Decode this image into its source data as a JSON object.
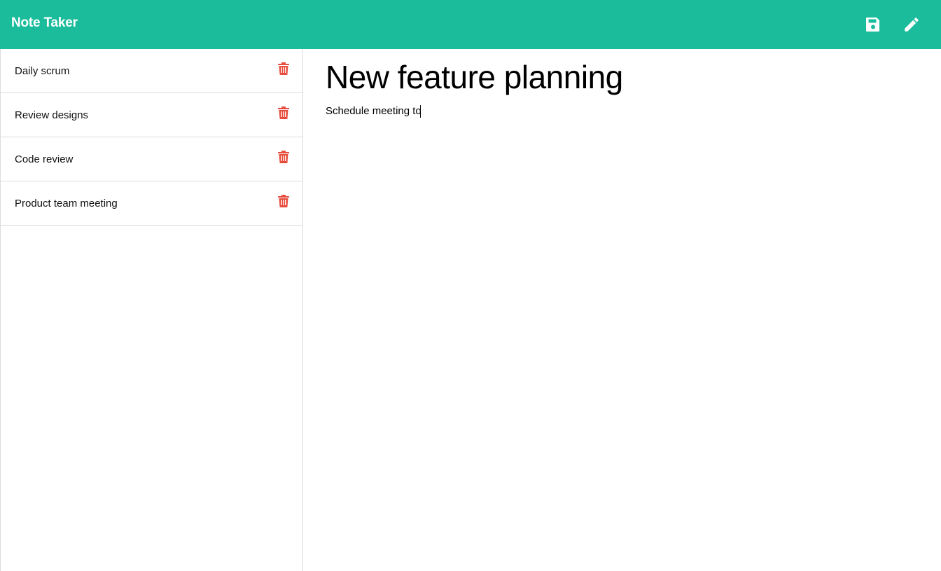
{
  "app": {
    "title": "Note Taker",
    "accent_color": "#1abc9c",
    "danger_color": "#e74c3c"
  },
  "toolbar": {
    "save_icon": "save-icon",
    "edit_icon": "pencil-icon"
  },
  "sidebar": {
    "notes": [
      {
        "label": "Daily scrum"
      },
      {
        "label": "Review designs"
      },
      {
        "label": "Code review"
      },
      {
        "label": "Product team meeting"
      }
    ]
  },
  "editor": {
    "title_value": "New feature planning",
    "body_value": "Schedule meeting to"
  }
}
